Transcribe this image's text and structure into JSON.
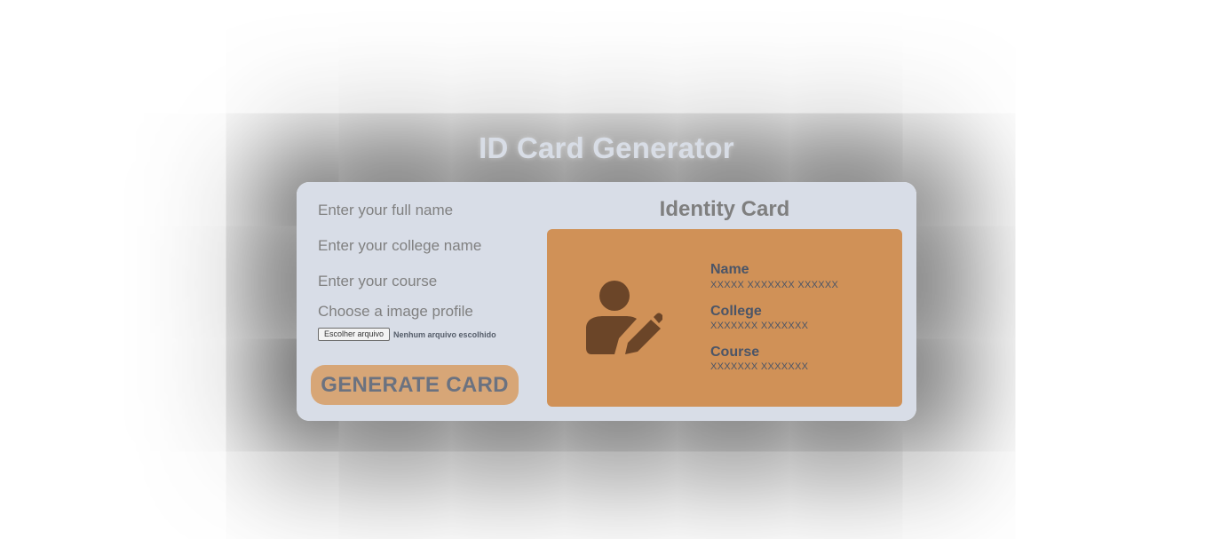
{
  "page": {
    "title": "ID Card Generator"
  },
  "form": {
    "name_placeholder": "Enter your full name",
    "college_placeholder": "Enter your college name",
    "course_placeholder": "Enter your course",
    "image_label": "Choose a image profile",
    "file_button_label": "Escolher arquivo",
    "file_status": "Nenhum arquivo escolhido",
    "generate_label": "GENERATE CARD"
  },
  "card": {
    "heading": "Identity Card",
    "avatar_icon": "user-edit-icon",
    "name_label": "Name",
    "name_value": "XXXXX XXXXXXX XXXXXX",
    "college_label": "College",
    "college_value": "XXXXXXX XXXXXXX",
    "course_label": "Course",
    "course_value": "XXXXXXX XXXXXXX"
  },
  "colors": {
    "panel_bg": "#d8dde7",
    "card_bg": "#d09157",
    "button_bg": "#d7a677",
    "icon_color": "#6b4528",
    "text_dark": "#4b5567"
  }
}
